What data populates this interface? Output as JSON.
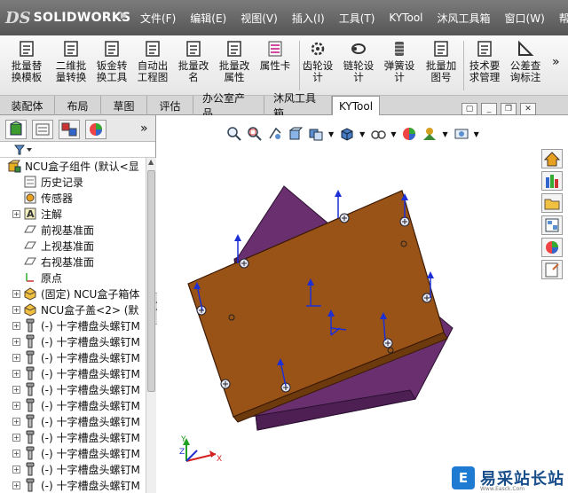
{
  "app": {
    "logo_prefix": "DS",
    "logo_text": "SOLIDWORKS"
  },
  "menu": [
    "文件(F)",
    "编辑(E)",
    "视图(V)",
    "插入(I)",
    "工具(T)",
    "KYTool",
    "沐风工具箱",
    "窗口(W)",
    "帮助(H)"
  ],
  "ribbon": {
    "buttons": [
      "批量替\n换模板",
      "二维批\n量转换",
      "钣金转\n换工具",
      "自动出\n工程图",
      "批量改\n名",
      "批量改\n属性",
      "属性卡",
      "齿轮设\n计",
      "链轮设\n计",
      "弹簧设\n计",
      "批量加\n图号",
      "技术要\n求管理",
      "公差查\n询标注"
    ],
    "more": "»"
  },
  "tabs": [
    "装配体",
    "布局",
    "草图",
    "评估",
    "办公室产品",
    "沐风工具箱",
    "KYTool"
  ],
  "active_tab": "KYTool",
  "panel": {
    "more": "»",
    "tree": [
      {
        "label": "NCU盒子组件 (默认<显",
        "indent": 0,
        "exp": "",
        "icon": "assembly"
      },
      {
        "label": "历史记录",
        "indent": 1,
        "exp": "",
        "icon": "history"
      },
      {
        "label": "传感器",
        "indent": 1,
        "exp": "",
        "icon": "sensor"
      },
      {
        "label": "注解",
        "indent": 1,
        "exp": "+",
        "icon": "annotation"
      },
      {
        "label": "前视基准面",
        "indent": 1,
        "exp": "",
        "icon": "plane"
      },
      {
        "label": "上视基准面",
        "indent": 1,
        "exp": "",
        "icon": "plane"
      },
      {
        "label": "右视基准面",
        "indent": 1,
        "exp": "",
        "icon": "plane"
      },
      {
        "label": "原点",
        "indent": 1,
        "exp": "",
        "icon": "origin"
      },
      {
        "label": "(固定) NCU盒子箱体",
        "indent": 1,
        "exp": "+",
        "icon": "part"
      },
      {
        "label": "NCU盒子盖<2> (默",
        "indent": 1,
        "exp": "+",
        "icon": "part"
      },
      {
        "label": "(-) 十字槽盘头螺钉M",
        "indent": 1,
        "exp": "+",
        "icon": "screw"
      },
      {
        "label": "(-) 十字槽盘头螺钉M",
        "indent": 1,
        "exp": "+",
        "icon": "screw"
      },
      {
        "label": "(-) 十字槽盘头螺钉M",
        "indent": 1,
        "exp": "+",
        "icon": "screw"
      },
      {
        "label": "(-) 十字槽盘头螺钉M",
        "indent": 1,
        "exp": "+",
        "icon": "screw"
      },
      {
        "label": "(-) 十字槽盘头螺钉M",
        "indent": 1,
        "exp": "+",
        "icon": "screw"
      },
      {
        "label": "(-) 十字槽盘头螺钉M",
        "indent": 1,
        "exp": "+",
        "icon": "screw"
      },
      {
        "label": "(-) 十字槽盘头螺钉M",
        "indent": 1,
        "exp": "+",
        "icon": "screw"
      },
      {
        "label": "(-) 十字槽盘头螺钉M",
        "indent": 1,
        "exp": "+",
        "icon": "screw"
      },
      {
        "label": "(-) 十字槽盘头螺钉M",
        "indent": 1,
        "exp": "+",
        "icon": "screw"
      },
      {
        "label": "(-) 十字槽盘头螺钉M",
        "indent": 1,
        "exp": "+",
        "icon": "screw"
      },
      {
        "label": "(-) 十字槽盘头螺钉M",
        "indent": 1,
        "exp": "+",
        "icon": "screw"
      }
    ]
  },
  "watermark": {
    "text": "易采站长站",
    "sub": "Www.Easck.Com"
  },
  "colors": {
    "lid": "#9a5317",
    "base": "#6a2f6e",
    "arrow": "#1c2fd4",
    "axis_x": "#d42020",
    "axis_y": "#20a020",
    "axis_z": "#2030d0"
  }
}
